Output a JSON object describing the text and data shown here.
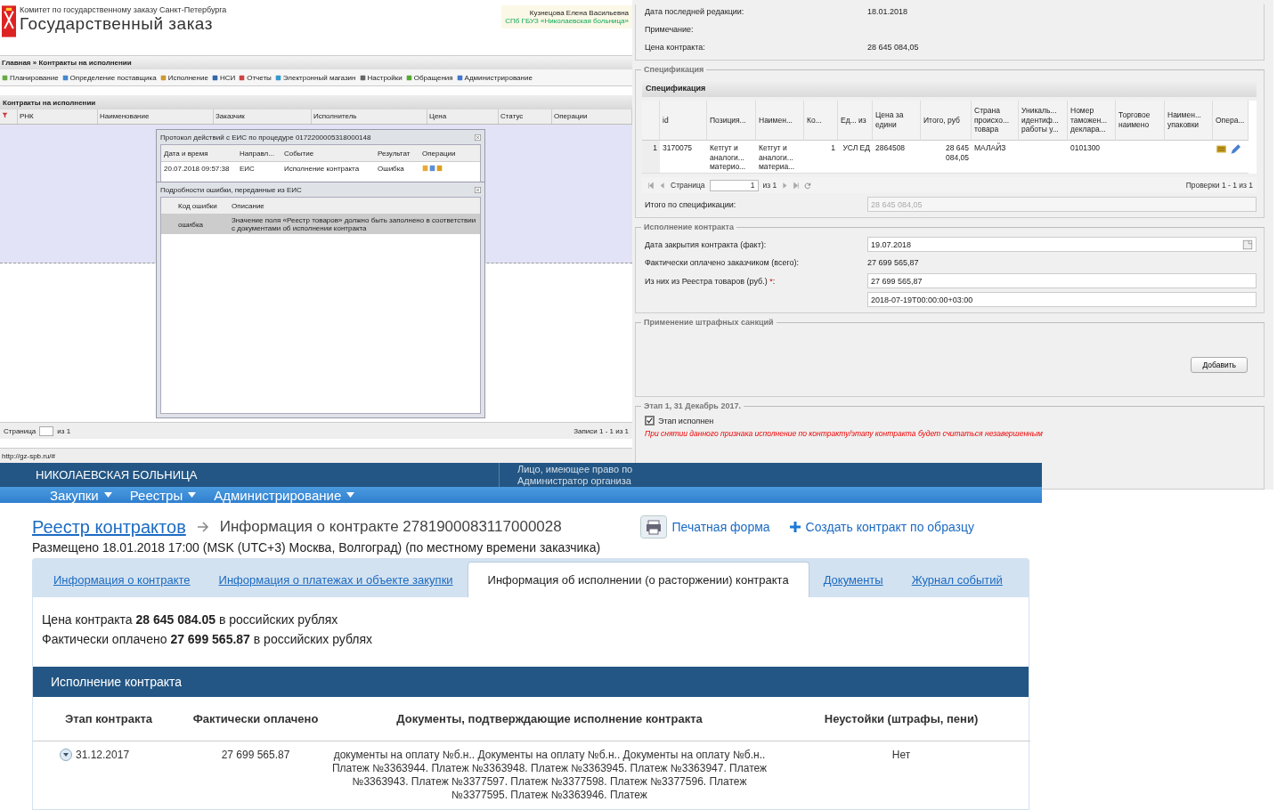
{
  "legacy_window": {
    "org": "Комитет по государственному заказу Санкт-Петербурга",
    "title": "Государственный заказ",
    "user": "Кузнецова Елена Васильевна",
    "user_org": "СПб ГБУЗ «Николаевская больница»",
    "breadcrumb": "Главная » Контракты на исполнении",
    "menu": [
      "Планирование",
      "Определение поставщика",
      "Исполнение",
      "НСИ",
      "Отчеты",
      "Электронный магазин",
      "Настройки",
      "Обращения",
      "Администрирование"
    ],
    "grid_title": "Контракты на исполнении",
    "columns": [
      "РНК",
      "Наименование",
      "Заказчик",
      "Исполнитель",
      "Цена",
      "Статус",
      "Операции"
    ],
    "protocol_dialog": {
      "title": "Протокол действий с ЕИС по процедуре 0172200005318000148",
      "columns": [
        "Дата и время",
        "Направл...",
        "Событие",
        "Результат",
        "Операции"
      ],
      "rows": [
        [
          "20.07.2018 09:57:38",
          "ЕИС",
          "Исполнение контракта",
          "Ошибка"
        ]
      ]
    },
    "error_dialog": {
      "title": "Подробности ошибки, переданные из ЕИС",
      "columns": [
        "",
        "Код ошибки",
        "Описание"
      ],
      "rows": [
        [
          "",
          "ошибка",
          "Значение поля «Реестр товаров» должно быть заполнено в соответствии с документами об исполнении контракта"
        ]
      ]
    },
    "pager": {
      "label": "Страница",
      "total": "из 1",
      "summary": "Записи 1 - 1 из 1"
    },
    "status_url": "http://gz-spb.ru/#"
  },
  "contract_form": {
    "fields": [
      {
        "label": "Дата последней редакции:",
        "value": "18.01.2018"
      },
      {
        "label": "Примечание:"
      },
      {
        "label": "Цена контракта:",
        "value": "28 645 084,05"
      }
    ],
    "specification": {
      "legend": "Спецификация",
      "grid_title": "Спецификация",
      "columns": [
        "",
        "id",
        "Позиция...",
        "Наимен...",
        "Ко...",
        "Ед... из",
        "Цена за едини",
        "Итого, руб",
        "Страна происхо... товара",
        "Уникаль... идентиф... работы у...",
        "Номер таможен... деклара...",
        "Торговое наимено",
        "Наимен... упаковки",
        "Опера..."
      ],
      "rows": [
        [
          "1",
          "3170075",
          "Кетгут и аналоги... материо...",
          "Кетгут и аналоги... материа...",
          "1",
          "УСЛ ЕД",
          "2864508",
          "28 645 084,05",
          "МАЛАЙЗ",
          "",
          "0101300",
          "",
          ""
        ]
      ],
      "pager": {
        "label": "Страница",
        "page": "1",
        "total": "из 1",
        "summary": "Проверки 1 - 1 из 1"
      },
      "total_label": "Итого по спецификации:",
      "total_value": "28 645 084,05"
    },
    "execution": {
      "legend": "Исполнение контракта",
      "close_date_label": "Дата закрытия контракта (факт):",
      "close_date": "19.07.2018",
      "paid_label": "Фактически оплачено заказчиком (всего):",
      "paid": "27 699 565,87",
      "registry_label": "Из них из Реестра товаров (руб.)",
      "required": "*",
      "registry_suffix": ":",
      "registry_value": "27 699 565,87",
      "timestamp": "2018-07-19T00:00:00+03:00"
    },
    "penalties": {
      "legend": "Применение штрафных санкций",
      "button": "Добавить"
    },
    "stage": {
      "legend": "Этап 1, 31 Декабрь 2017.",
      "checkbox_label": "Этап исполнен",
      "checked": true,
      "warning": "При снятии данного признака исполнение по контракту/этапу контракта будет считаться незавершенным"
    }
  },
  "portal": {
    "org": "НИКОЛАЕВСКАЯ БОЛЬНИЦА",
    "user_lines": [
      "Лицо, имеющее право по",
      "Администратор организа"
    ],
    "nav": [
      "Закупки",
      "Реестры",
      "Администрирование"
    ],
    "breadcrumb_link": "Реестр контрактов",
    "page_title": "Информация о контракте 2781900083117000028",
    "actions": [
      "Печатная форма",
      "Создать контракт по образцу"
    ],
    "placed": "Размещено 18.01.2018 17:00 (MSK (UTC+3) Москва, Волгоград) (по местному времени заказчика)",
    "tabs": [
      {
        "label": "Информация о контракте",
        "selected": false
      },
      {
        "label": "Информация о платежах и объекте закупки",
        "selected": false
      },
      {
        "label": "Информация об исполнении (о расторжении) контракта",
        "selected": true
      },
      {
        "label": "Документы",
        "selected": false
      },
      {
        "label": "Журнал событий",
        "selected": false
      }
    ],
    "summary": [
      "Цена контракта **28 645 084.05** в российских рублях",
      "Фактически оплачено **27 699 565.87** в российских рублях"
    ],
    "section_title": "Исполнение контракта",
    "table": {
      "columns": [
        "Этап контракта",
        "Фактически оплачено",
        "Документы, подтверждающие исполнение контракта",
        "Неустойки (штрафы, пени)"
      ],
      "rows": [
        {
          "expanded": false,
          "cells": [
            "31.12.2017",
            "27 699 565.87",
            "документы на оплату №б.н.. Документы на оплату №б.н.. Документы на оплату №б.н.. Платеж №3363944. Платеж №3363948. Платеж №3363945. Платеж №3363947. Платеж №3363943. Платеж №3377597. Платеж №3377598. Платеж №3377596. Платеж №3377595. Платеж №3363946. Платеж",
            "Нет"
          ]
        }
      ]
    }
  }
}
